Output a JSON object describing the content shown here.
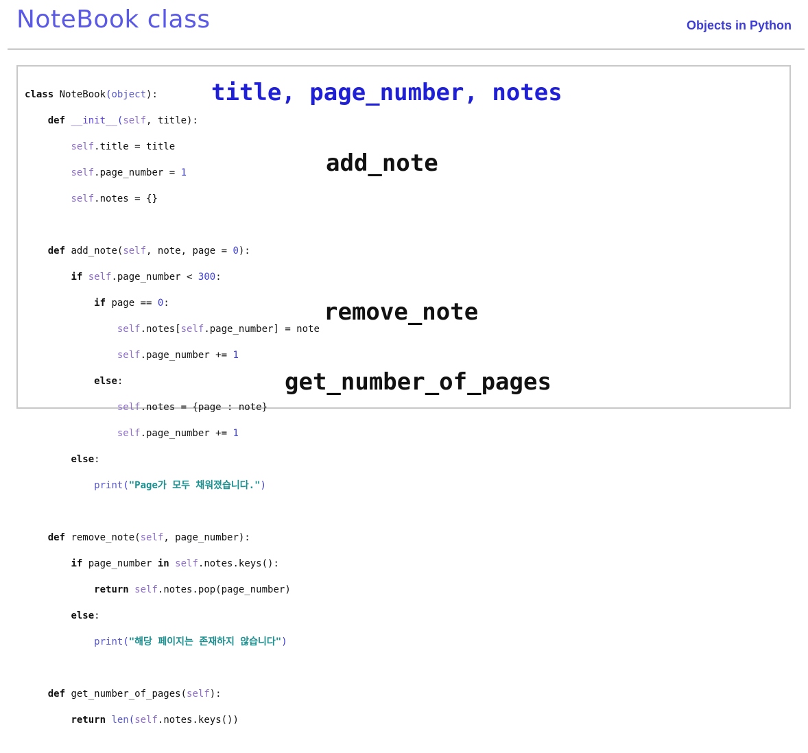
{
  "header": {
    "title": "NoteBook class",
    "section": "Objects in Python"
  },
  "code": {
    "l1": {
      "kw": "class",
      "name": " NoteBook",
      "open": "(",
      "base": "object",
      "close": "):"
    },
    "l2": {
      "kw": "def",
      "dunder": "__init__",
      "open": "(",
      "self": "self",
      "rest": ", title):"
    },
    "l3": {
      "self": "self",
      "rest": ".title = title"
    },
    "l4": {
      "self": "self",
      "rest": ".page_number = ",
      "num": "1"
    },
    "l5": {
      "self": "self",
      "rest": ".notes = {}"
    },
    "l6": {
      "kw": "def",
      "name": " add_note(",
      "self": "self",
      "rest": ", note, page = ",
      "num": "0",
      "end": "):"
    },
    "l7": {
      "kw": "if",
      "sp": " ",
      "self": "self",
      "rest": ".page_number < ",
      "num": "300",
      "end": ":"
    },
    "l8": {
      "kw": "if",
      "rest": " page == ",
      "num": "0",
      "end": ":"
    },
    "l9": {
      "self1": "self",
      "rest1": ".notes[",
      "self2": "self",
      "rest2": ".page_number] = note"
    },
    "l10": {
      "self": "self",
      "rest": ".page_number += ",
      "num": "1"
    },
    "l11": {
      "kw": "else",
      "end": ":"
    },
    "l12": {
      "self": "self",
      "rest": ".notes = {page : note}"
    },
    "l13": {
      "self": "self",
      "rest": ".page_number += ",
      "num": "1"
    },
    "l14": {
      "kw": "else",
      "end": ":"
    },
    "l15": {
      "fn": "print",
      "open": "(",
      "str": "\"Page가 모두 채워졌습니다.\"",
      "close": ")"
    },
    "l16": {
      "kw": "def",
      "name": " remove_note(",
      "self": "self",
      "rest": ", page_number):"
    },
    "l17": {
      "kw": "if",
      "rest1": " page_number ",
      "kw2": "in",
      "sp": " ",
      "self": "self",
      "rest2": ".notes.keys():"
    },
    "l18": {
      "kw": "return",
      "sp": " ",
      "self": "self",
      "rest": ".notes.pop(page_number)"
    },
    "l19": {
      "kw": "else",
      "end": ":"
    },
    "l20": {
      "fn": "print",
      "open": "(",
      "str": "\"해당 페이지는 존재하지 않습니다\"",
      "close": ")"
    },
    "l21": {
      "kw": "def",
      "name": " get_number_of_pages(",
      "self": "self",
      "end": "):"
    },
    "l22": {
      "kw": "return",
      "sp": " ",
      "fn": "len",
      "open": "(",
      "self": "self",
      "rest": ".notes.keys())"
    }
  },
  "callouts": {
    "init": "title, page_number, notes",
    "add": "add_note",
    "remove": "remove_note",
    "count": "get_number_of_pages"
  },
  "colors": {
    "title": "#5a5ae6",
    "section": "#3d3dd6",
    "self_kw": "#8c6ec8",
    "number": "#3f3fd9",
    "string": "#1c8f8f",
    "callout_init": "#1f1fd6"
  }
}
